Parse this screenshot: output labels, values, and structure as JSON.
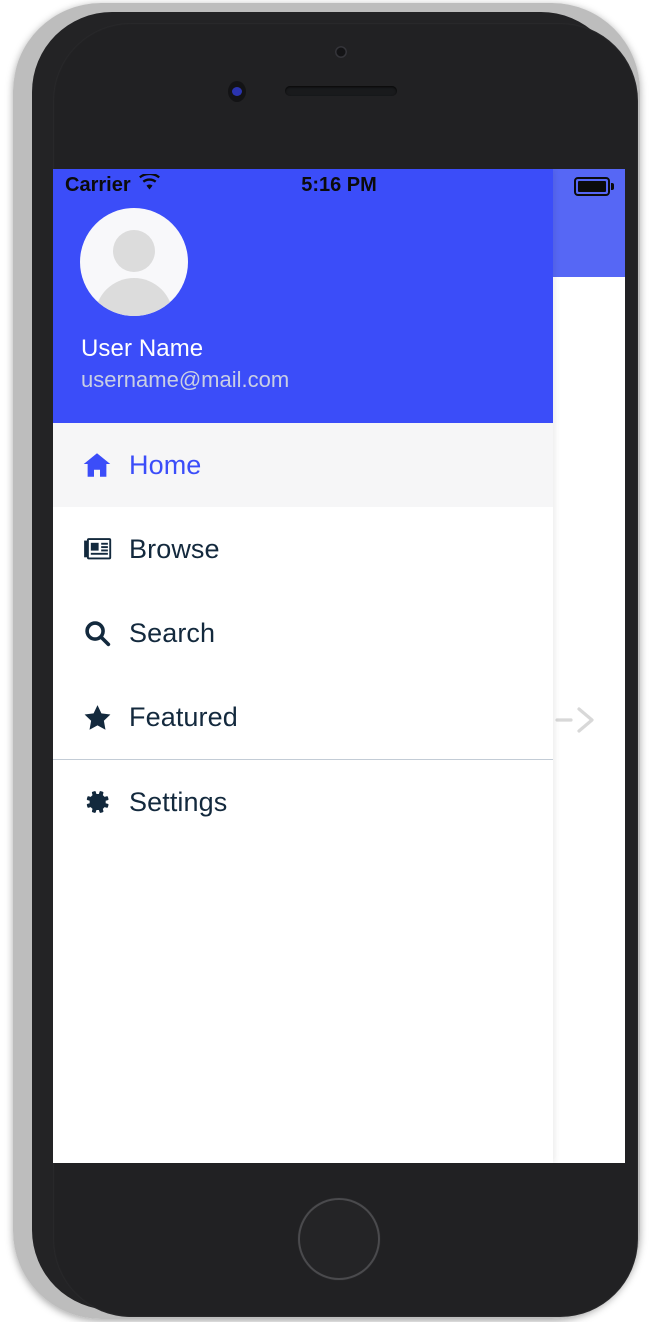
{
  "device": {
    "kind": "smartphone-mockup",
    "frame_color": "#232325"
  },
  "status_bar": {
    "carrier": "Carrier",
    "wifi_icon": "wifi-icon",
    "time": "5:16 PM",
    "battery_icon": "battery-full-icon",
    "text_color": "#0b0b0b"
  },
  "drawer": {
    "background": "#ffffff",
    "header": {
      "background_color": "#3b4df9",
      "avatar_icon": "user-avatar-placeholder-icon",
      "name": "User Name",
      "email": "username@mail.com",
      "name_color": "#ffffff",
      "email_color": "#c9cfe4"
    },
    "menu": [
      {
        "label": "Home",
        "icon": "home-icon",
        "active": true
      },
      {
        "label": "Browse",
        "icon": "newspaper-icon",
        "active": false
      },
      {
        "label": "Search",
        "icon": "search-icon",
        "active": false
      },
      {
        "label": "Featured",
        "icon": "star-icon",
        "active": false
      },
      {
        "label": "Settings",
        "icon": "gear-icon",
        "active": false
      }
    ],
    "divider_after_index": 3,
    "active_item_background": "#f6f6f7",
    "active_item_color": "#3b4df9",
    "item_color": "#13293d"
  },
  "main_content": {
    "navbar_color": "#5667f5",
    "body_color": "#ffffff",
    "swipe_arrow_icon": "arrow-right-icon",
    "swipe_arrow_color": "#d8d8d8"
  }
}
